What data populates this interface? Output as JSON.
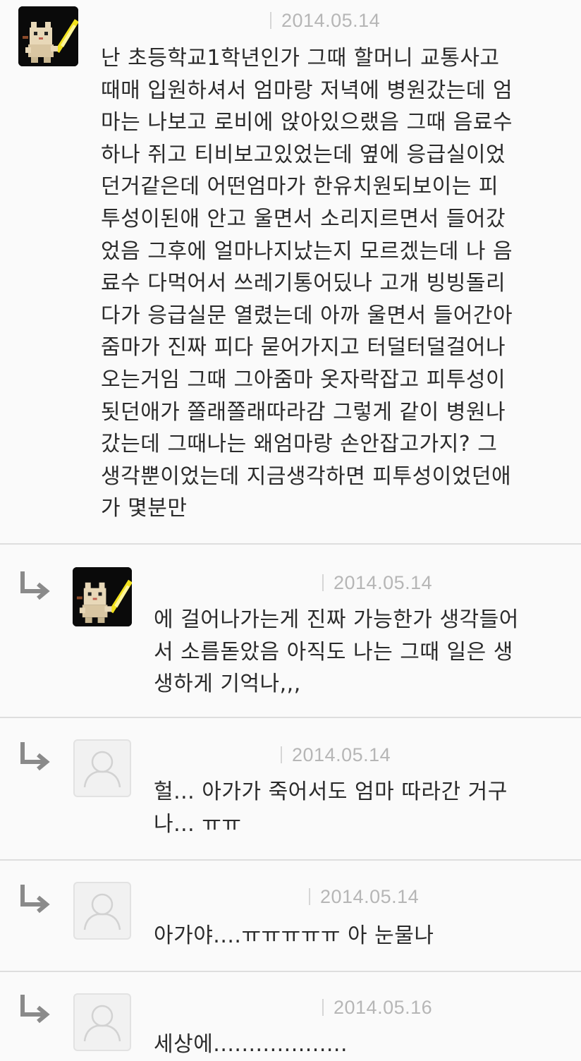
{
  "comments": [
    {
      "is_reply": false,
      "avatar": "pixel-cat-avatar",
      "date": "2014.05.14",
      "text": "난 초등학교1학년인가 그때 할머니 교통사고\n때매 입원하셔서 엄마랑 저녁에 병원갔는데 엄\n마는 나보고 로비에 앉아있으랬음 그때 음료수\n하나 쥐고 티비보고있었는데 옆에 응급실이었\n던거같은데 어떤엄마가 한유치원되보이는 피\n투성이된애 안고 울면서 소리지르면서 들어갔\n었음 그후에 얼마나지났는지 모르겠는데 나 음\n료수 다먹어서 쓰레기통어딨나 고개 빙빙돌리\n다가 응급실문 열렸는데 아까 울면서 들어간아\n줌마가 진짜 피다 묻어가지고 터덜터덜걸어나\n오는거임 그때 그아줌마 옷자락잡고 피투성이\n됫던애가 쫄래쫄래따라감 그렇게 같이 병원나\n갔는데 그때나는 왜엄마랑 손안잡고가지? 그\n생각뿐이었는데 지금생각하면 피투성이었던애\n가 몇분만"
    },
    {
      "is_reply": true,
      "avatar": "pixel-cat-avatar",
      "date": "2014.05.14",
      "text": "에 걸어나가는게 진짜 가능한가 생각들어\n서 소름돋았음 아직도 나는 그때 일은 생\n생하게 기억나,,,"
    },
    {
      "is_reply": true,
      "avatar": "default-user-avatar",
      "date": "2014.05.14",
      "text": "헐... 아가가 죽어서도 엄마 따라간 거구\n나... ㅠㅠ"
    },
    {
      "is_reply": true,
      "avatar": "default-user-avatar",
      "date": "2014.05.14",
      "text": "아가야....ㅠㅠㅠㅠㅠ 아 눈물나"
    },
    {
      "is_reply": true,
      "avatar": "default-user-avatar",
      "date": "2014.05.16",
      "text": "세상에..................."
    }
  ],
  "colors": {
    "background": "#fafafa",
    "divider": "#dedede",
    "date_text": "#b6b6b6",
    "body_text": "#2b2b2b",
    "reply_arrow": "#8a8a8a",
    "cat_sword": "#f2e21b"
  }
}
